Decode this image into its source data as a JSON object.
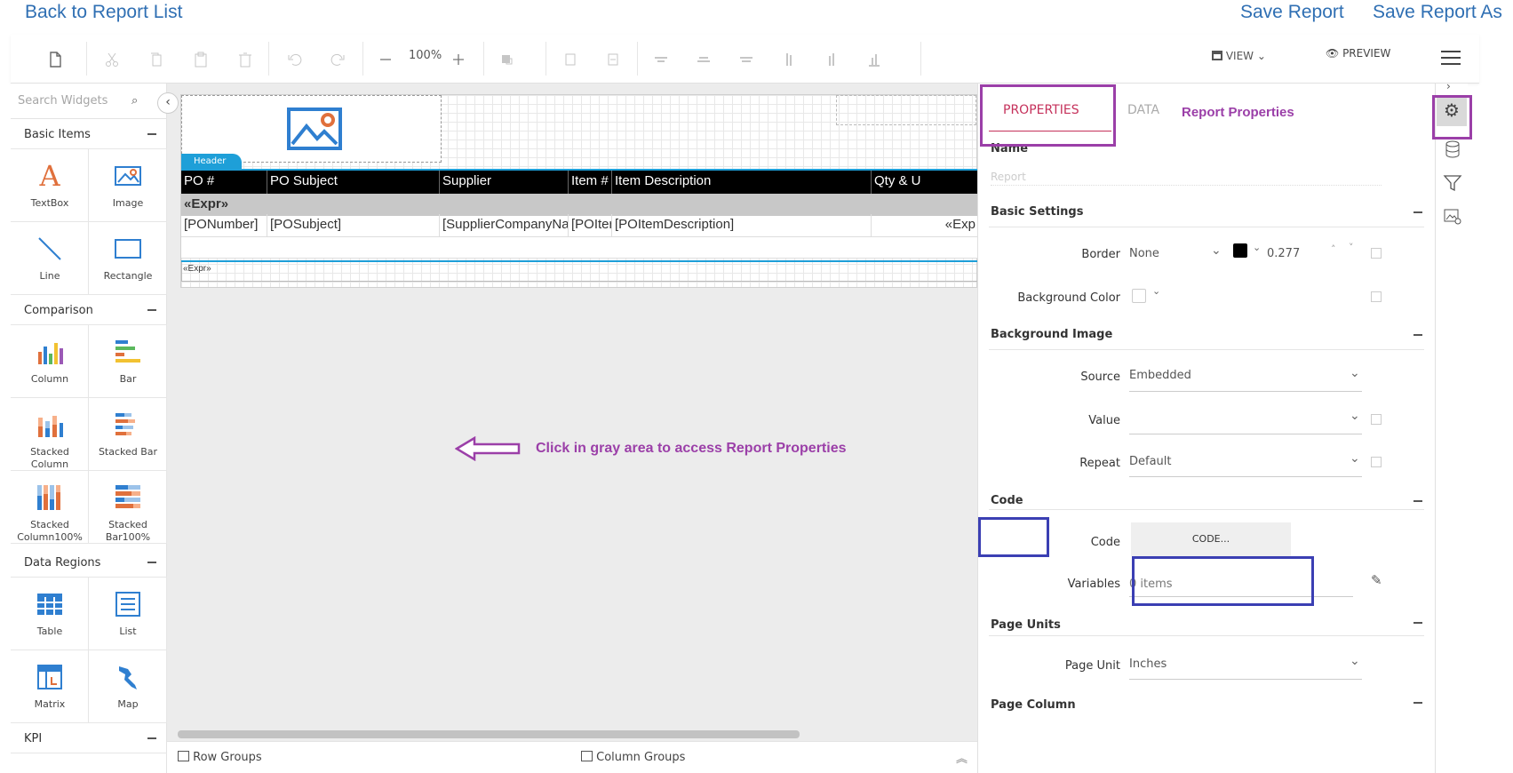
{
  "nav": {
    "back_label": "Back to Report List",
    "save_label": "Save Report",
    "save_as_label": "Save Report As"
  },
  "toolbar": {
    "zoom": "100%",
    "view_label": "VIEW",
    "preview_label": "PREVIEW"
  },
  "widgets": {
    "search_placeholder": "Search Widgets",
    "sections": {
      "basic": "Basic Items",
      "comparison": "Comparison",
      "data_regions": "Data Regions",
      "kpi": "KPI"
    },
    "items": {
      "textbox": "TextBox",
      "image": "Image",
      "line": "Line",
      "rectangle": "Rectangle",
      "column": "Column",
      "bar": "Bar",
      "stacked_column": "Stacked Column",
      "stacked_bar": "Stacked Bar",
      "stacked_column100": "Stacked Column100%",
      "stacked_bar100": "Stacked Bar100%",
      "table": "Table",
      "list": "List",
      "matrix": "Matrix",
      "map": "Map"
    }
  },
  "report": {
    "header_tag": "Header",
    "columns": [
      "PO #",
      "PO Subject",
      "Supplier",
      "Item #",
      "Item Description",
      "Qty & U"
    ],
    "group_row": "«Expr»",
    "detail_row": [
      "[PONumber]",
      "[POSubject]",
      "[SupplierCompanyNam",
      "[POIter",
      "[POItemDescription]",
      "«Exp"
    ],
    "footer_expr": "«Expr»"
  },
  "annotation": {
    "text": "Click in gray area to access Report Properties"
  },
  "bottom": {
    "row_groups": "Row Groups",
    "column_groups": "Column Groups"
  },
  "props": {
    "tab_properties": "PROPERTIES",
    "tab_data": "DATA",
    "title": "Report Properties",
    "name_label": "Name",
    "name_placeholder": "Report",
    "basic_settings": "Basic Settings",
    "border_label": "Border",
    "border_value": "None",
    "border_width": "0.277",
    "bg_color_label": "Background Color",
    "background_image": "Background Image",
    "source_label": "Source",
    "source_value": "Embedded",
    "value_label": "Value",
    "repeat_label": "Repeat",
    "repeat_value": "Default",
    "code_section": "Code",
    "code_label": "Code",
    "code_button": "CODE...",
    "variables_label": "Variables",
    "variables_value": "0 items",
    "page_units": "Page Units",
    "page_unit_label": "Page Unit",
    "page_unit_value": "Inches",
    "page_column": "Page Column"
  },
  "colors": {
    "link": "#2f6fb3",
    "annotation": "#9b3fa8",
    "highlight_purple": "#9b3fa8",
    "highlight_blue": "#3b3fb3",
    "header_tab": "#1e9fd8"
  }
}
